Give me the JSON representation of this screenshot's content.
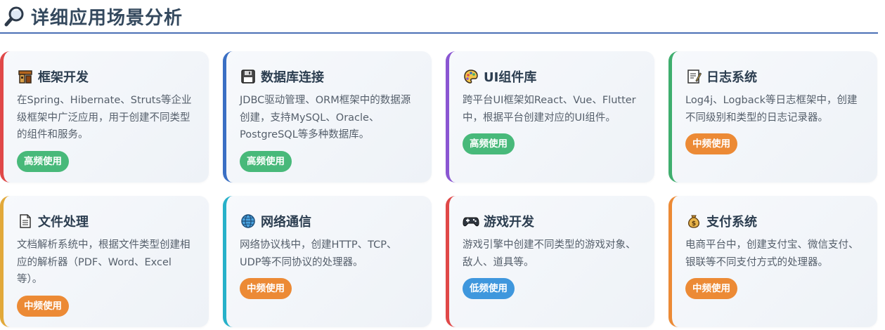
{
  "header": {
    "title": "详细应用场景分析",
    "icon": "magnifier-icon"
  },
  "cards": [
    {
      "title": "框架开发",
      "icon": "building-blocks-icon",
      "accent": "#e04848",
      "desc": "在Spring、Hibernate、Struts等企业级框架中广泛应用，用于创建不同类型的组件和服务。",
      "badge": "高频使用",
      "badge_color": "#48b97a"
    },
    {
      "title": "数据库连接",
      "icon": "floppy-disk-icon",
      "accent": "#3a6fc4",
      "desc": "JDBC驱动管理、ORM框架中的数据源创建，支持MySQL、Oracle、PostgreSQL等多种数据库。",
      "badge": "高频使用",
      "badge_color": "#48b97a"
    },
    {
      "title": "UI组件库",
      "icon": "palette-icon",
      "accent": "#8a56d2",
      "desc": "跨平台UI框架如React、Vue、Flutter中，根据平台创建对应的UI组件。",
      "badge": "高频使用",
      "badge_color": "#48b97a"
    },
    {
      "title": "日志系统",
      "icon": "memo-icon",
      "accent": "#3fae6e",
      "desc": "Log4j、Logback等日志框架中，创建不同级别和类型的日志记录器。",
      "badge": "中频使用",
      "badge_color": "#ec8a35"
    },
    {
      "title": "文件处理",
      "icon": "document-icon",
      "accent": "#e2a93a",
      "desc": "文档解析系统中，根据文件类型创建相应的解析器（PDF、Word、Excel等）。",
      "badge": "中频使用",
      "badge_color": "#ec8a35"
    },
    {
      "title": "网络通信",
      "icon": "globe-icon",
      "accent": "#27b1c9",
      "desc": "网络协议栈中，创建HTTP、TCP、UDP等不同协议的处理器。",
      "badge": "中频使用",
      "badge_color": "#ec8a35"
    },
    {
      "title": "游戏开发",
      "icon": "gamepad-icon",
      "accent": "#e04848",
      "desc": "游戏引擎中创建不同类型的游戏对象、敌人、道具等。",
      "badge": "低频使用",
      "badge_color": "#3f97dd"
    },
    {
      "title": "支付系统",
      "icon": "money-bag-icon",
      "accent": "#ec8a35",
      "desc": "电商平台中，创建支付宝、微信支付、银联等不同支付方式的处理器。",
      "badge": "中频使用",
      "badge_color": "#ec8a35"
    }
  ]
}
